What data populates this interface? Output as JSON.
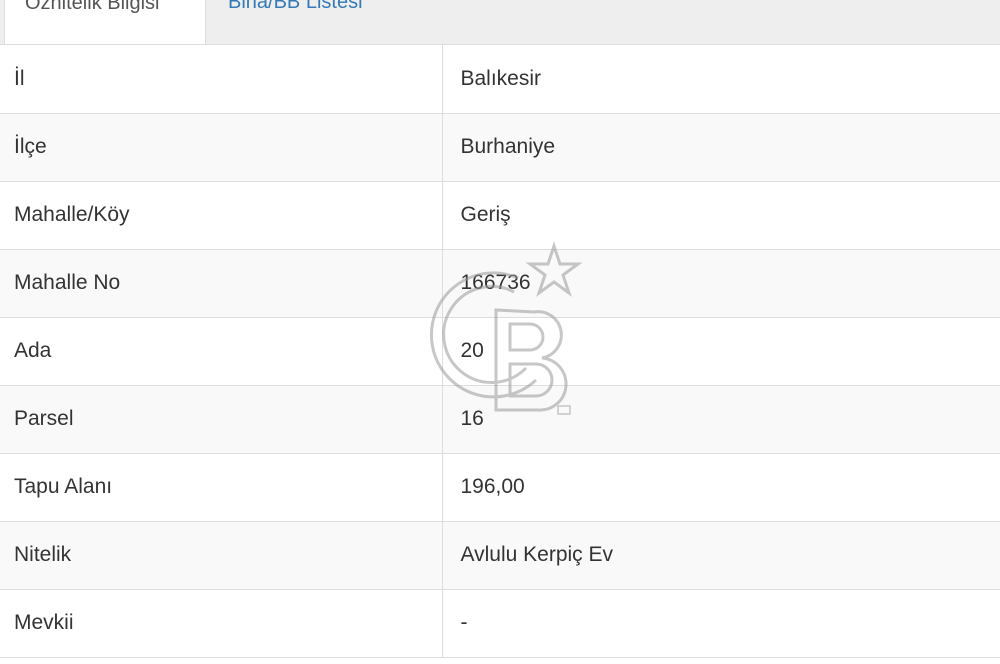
{
  "tabs": [
    {
      "label": "Öznitelik Bilgisi",
      "active": true
    },
    {
      "label": "Bina/BB Listesi",
      "active": false
    }
  ],
  "colors": {
    "tab_link": "#337ab7",
    "border": "#dddddd",
    "stripe": "#f9f9f9"
  },
  "watermark_icon": "cb-logo-icon",
  "rows": [
    {
      "label": "İl",
      "value": "Balıkesir"
    },
    {
      "label": "İlçe",
      "value": "Burhaniye"
    },
    {
      "label": "Mahalle/Köy",
      "value": "Geriş"
    },
    {
      "label": "Mahalle No",
      "value": "166736"
    },
    {
      "label": "Ada",
      "value": "20"
    },
    {
      "label": "Parsel",
      "value": "16"
    },
    {
      "label": "Tapu Alanı",
      "value": "196,00"
    },
    {
      "label": "Nitelik",
      "value": "Avlulu Kerpiç Ev"
    },
    {
      "label": "Mevkii",
      "value": "-"
    }
  ]
}
